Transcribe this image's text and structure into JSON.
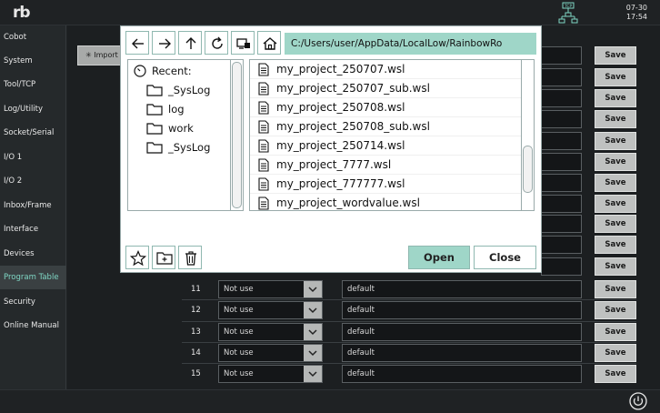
{
  "header": {
    "logo_text": "rb",
    "tcp_label": "TCP",
    "date": "07-30",
    "time": "17:54"
  },
  "sidebar": {
    "items": [
      {
        "label": "Cobot"
      },
      {
        "label": "System"
      },
      {
        "label": "Tool/TCP"
      },
      {
        "label": "Log/Utility"
      },
      {
        "label": "Socket/Serial"
      },
      {
        "label": "I/O 1"
      },
      {
        "label": "I/O 2"
      },
      {
        "label": "Inbox/Frame"
      },
      {
        "label": "Interface"
      },
      {
        "label": "Devices"
      },
      {
        "label": "Program Table",
        "active": true
      },
      {
        "label": "Security"
      },
      {
        "label": "Online Manual"
      }
    ]
  },
  "program_table": {
    "import_label": "Import",
    "save_label": "Save",
    "rows": [
      {
        "num": "11",
        "mode": "Not use",
        "value": "default"
      },
      {
        "num": "12",
        "mode": "Not use",
        "value": "default"
      },
      {
        "num": "13",
        "mode": "Not use",
        "value": "default"
      },
      {
        "num": "14",
        "mode": "Not use",
        "value": "default"
      },
      {
        "num": "15",
        "mode": "Not use",
        "value": "default"
      }
    ]
  },
  "dialog": {
    "path": "C:/Users/user/AppData/LocalLow/RainbowRo",
    "toolbar_icons": [
      "arrow-left-icon",
      "arrow-right-icon",
      "arrow-up-icon",
      "refresh-icon",
      "drive-icon",
      "home-icon"
    ],
    "tree": {
      "recent_label": "Recent:",
      "folders": [
        "_SysLog",
        "log",
        "work",
        "_SysLog"
      ]
    },
    "files": [
      "my_project_250707.wsl",
      "my_project_250707_sub.wsl",
      "my_project_250708.wsl",
      "my_project_250708_sub.wsl",
      "my_project_250714.wsl",
      "my_project_7777.wsl",
      "my_project_777777.wsl",
      "my_project_wordvalue.wsl"
    ],
    "open_label": "Open",
    "close_label": "Close"
  }
}
